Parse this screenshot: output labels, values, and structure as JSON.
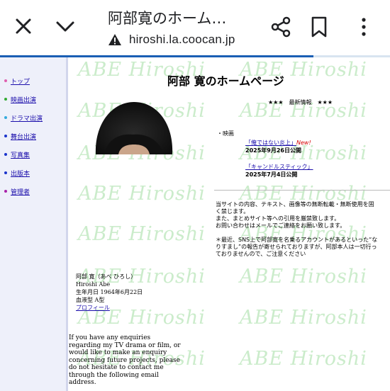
{
  "browser": {
    "tab_title": "阿部寛のホーム…",
    "url": "hiroshi.la.coocan.jp",
    "icons": [
      "close-icon",
      "chevron-down-icon",
      "warning-icon",
      "share-icon",
      "bookmark-icon",
      "more-vert-icon"
    ]
  },
  "nav": {
    "items": [
      {
        "label": "トップ",
        "color": "#e060b0"
      },
      {
        "label": "映画出演",
        "color": "#33aa33"
      },
      {
        "label": "ドラマ出演",
        "color": "#33aadd"
      },
      {
        "label": "舞台出演",
        "color": "#1a33cc"
      },
      {
        "label": "写真集",
        "color": "#1a33cc"
      },
      {
        "label": "出版本",
        "color": "#1a33cc"
      },
      {
        "label": "管理者",
        "color": "#aa22aa"
      }
    ]
  },
  "watermark": "ABE Hiroshi",
  "page_title": "阿部 寛のホームページ",
  "news": {
    "header": "★★★　最新情報　★★★",
    "category": "・映画",
    "items": [
      {
        "title": "「俺ではない炎上」",
        "new": "New!",
        "date": "2025年9月26日公開"
      },
      {
        "title": "「キャンドルスティック」",
        "new": "",
        "date": "2025年7月4日公開"
      }
    ]
  },
  "notice": {
    "lines": [
      "当サイトの内容、テキスト、画像等の無断転載・無断使用を固",
      "く禁じます。",
      "また、まとめサイト等への引用を厳禁致します。",
      "お問い合わせはメールでご連絡をお願い致します。",
      "",
      "＊最近、SNS上で阿部寛を名乗るアカウントがあるといった“な",
      "りすまし”の報告が寄せられておりますが、阿部本人は一切行っ",
      "ておりませんので、ご注意ください"
    ]
  },
  "profile": {
    "name_jp": "阿部 寛（あべ ひろし）",
    "name_en": "Hiroshi Abe",
    "birthday": "生年月日 1964年6月22日",
    "blood": "血液型 A型",
    "profile_link": "プロフィール"
  },
  "enquiry": "If you have any enquiries regarding my TV drama or film, or would like to make an enquiry concerning future projects, please do not hesitate to contact me through the following email address."
}
